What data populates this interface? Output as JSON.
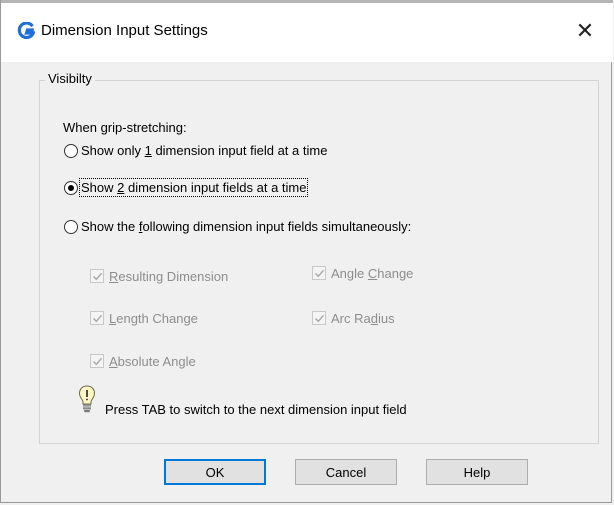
{
  "window": {
    "title": "Dimension Input Settings",
    "close_glyph": "✕",
    "app_icon": "g-logo-icon",
    "accent_color": "#1e6fd9"
  },
  "group": {
    "legend": "Visibilty",
    "intro": "When grip-stretching:"
  },
  "options": [
    {
      "pre": "Show only ",
      "mnemonic": "1",
      "post": " dimension input field at a time",
      "checked": false
    },
    {
      "pre": "Show ",
      "mnemonic": "2",
      "post": " dimension input fields at a time",
      "checked": true
    },
    {
      "pre": "Show the ",
      "mnemonic": "f",
      "post": "ollowing dimension input fields simultaneously:",
      "checked": false
    }
  ],
  "checkboxes": {
    "resulting_dimension": {
      "mnemonic": "R",
      "rest": "esulting Dimension",
      "checked": true,
      "enabled": false
    },
    "angle_change": {
      "pre": "Angle ",
      "mnemonic": "C",
      "rest": "hange",
      "checked": true,
      "enabled": false
    },
    "length_change": {
      "mnemonic": "L",
      "rest": "ength Change",
      "checked": true,
      "enabled": false
    },
    "arc_radius": {
      "pre": "Arc Ra",
      "mnemonic": "d",
      "rest": "ius",
      "checked": true,
      "enabled": false
    },
    "absolute_angle": {
      "mnemonic": "A",
      "rest": "bsolute Angle",
      "checked": true,
      "enabled": false
    }
  },
  "tip": {
    "icon": "lightbulb-icon",
    "text": "Press TAB to switch to the next dimension input field"
  },
  "buttons": {
    "ok": "OK",
    "cancel": "Cancel",
    "help": "Help"
  }
}
